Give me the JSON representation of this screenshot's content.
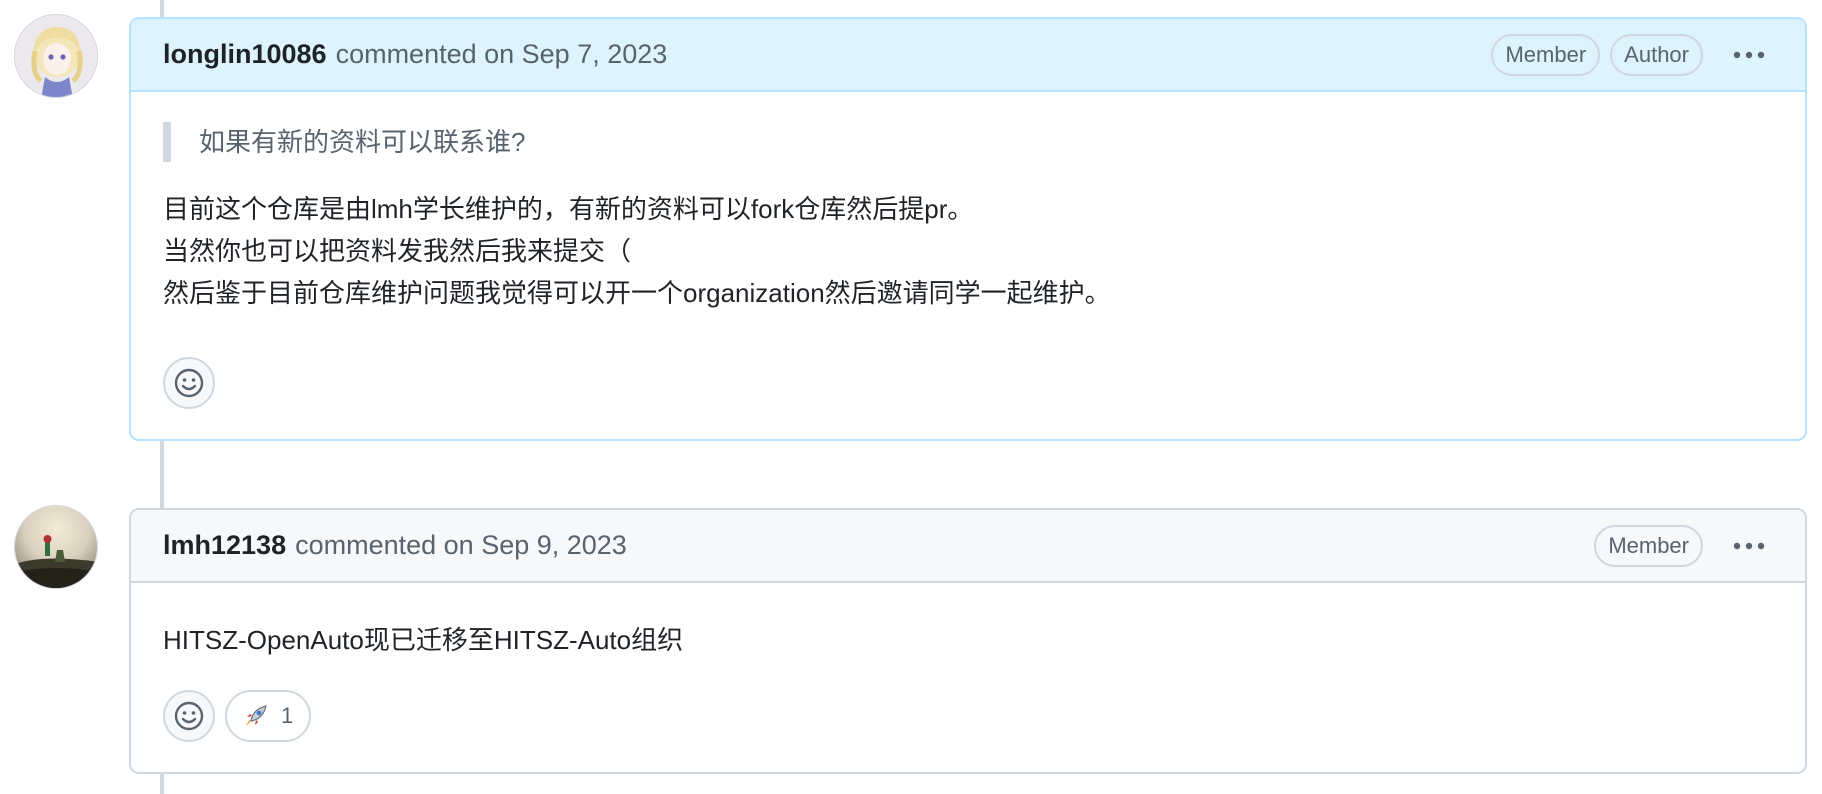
{
  "comments": [
    {
      "author": "longlin10086",
      "meta": "commented on Sep 7, 2023",
      "badges": [
        "Member",
        "Author"
      ],
      "quote": "如果有新的资料可以联系谁?",
      "paragraphs": [
        "目前这个仓库是由lmh学长维护的，有新的资料可以fork仓库然后提pr。",
        "当然你也可以把资料发我然后我来提交（",
        "然后鉴于目前仓库维护问题我觉得可以开一个organization然后邀请同学一起维护。"
      ],
      "reactions": []
    },
    {
      "author": "lmh12138",
      "meta": "commented on Sep 9, 2023",
      "badges": [
        "Member"
      ],
      "paragraphs": [
        "HITSZ-OpenAuto现已迁移至HITSZ-Auto组织"
      ],
      "reactions": [
        {
          "icon": "rocket-icon",
          "count": "1"
        }
      ]
    }
  ],
  "icons": {
    "kebab": "kebab-horizontal-icon",
    "add_reaction": "smiley-icon"
  },
  "colors": {
    "author_header_bg": "#ddf4ff",
    "author_border": "#b6e3ff",
    "default_header_bg": "#f6f8fa",
    "border": "#d0d7de",
    "muted_text": "#59636e",
    "text": "#1f2328"
  }
}
